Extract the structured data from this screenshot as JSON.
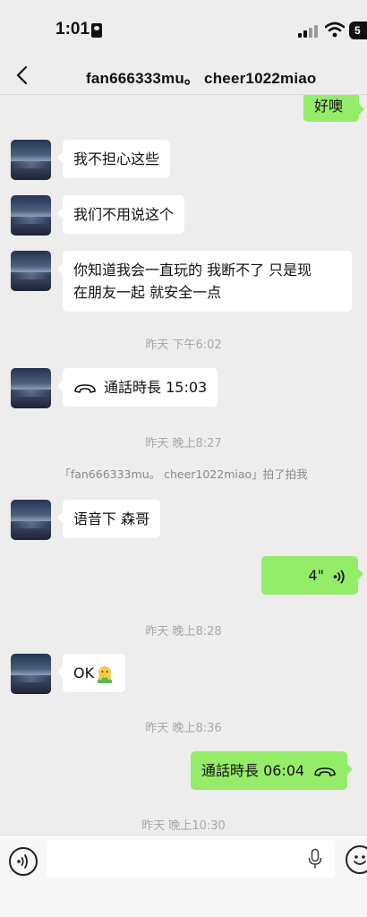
{
  "status_bar": {
    "time": "1:01",
    "battery": "5"
  },
  "header": {
    "title": "fan666333mu。  cheer1022miao"
  },
  "messages": {
    "m0": "好噢",
    "m1": "我不担心这些",
    "m2": "我们不用说这个",
    "m3_line1": "你知道我会一直玩的 我断不了 只是现",
    "m3_line2": "在朋友一起 就安全一点",
    "ts1": "昨天 下午6:02",
    "call1": "通話時長 15:03",
    "ts2": "昨天 晚上8:27",
    "pat_note": "「fan666333mu。 cheer1022miao」拍了拍我",
    "m4": "语音下 森哥",
    "voice_duration": "4\"",
    "ts3": "昨天 晚上8:28",
    "m5": "OK",
    "ts4": "昨天 晚上8:36",
    "call2": "通話時長 06:04",
    "ts5": "昨天 晚上10:30"
  },
  "colors": {
    "outgoing_bubble": "#95ec69",
    "incoming_bubble": "#ffffff",
    "background": "#ededed"
  },
  "icons": [
    "back-icon",
    "phone-icon",
    "voice-wave-icon",
    "voice-mode-icon",
    "microphone-icon",
    "emoji-icon"
  ]
}
